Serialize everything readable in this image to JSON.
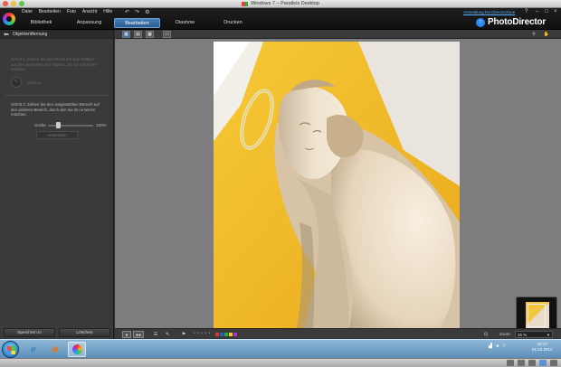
{
  "window": {
    "title": "Windows 7 – Parallels Desktop"
  },
  "menu": [
    "Datei",
    "Bearbeiten",
    "Foto",
    "Ansicht",
    "Hilfe"
  ],
  "header": {
    "register_link": "Anmeldung bei DirectorZone",
    "help": "?",
    "brand": "PhotoDirector"
  },
  "tabs": [
    {
      "label": "Bibliothek"
    },
    {
      "label": "Anpassung"
    },
    {
      "label": "Bearbeiten",
      "active": true
    },
    {
      "label": "Diashow"
    },
    {
      "label": "Drucken"
    }
  ],
  "panel": {
    "title": "Objektentfernung",
    "step1": "Schritt 1: Ziehen Sie den Pinsel mit dem Stiftbus aus den Bereichen des Objekts, die Sie entfernen möchten.",
    "brush_label": "Stiftbus",
    "step2": "Schritt 2: Ziehen Sie den ausgewählten Bereich auf den anderen Bereich, durch den Sie ihn ersetzen möchten.",
    "size_label": "Größe",
    "size_value": "100%",
    "apply": "Anwenden",
    "save_as": "Speichern in",
    "delete": "Löschen"
  },
  "bottombar": {
    "zoom_label": "Zoom:",
    "zoom_value": "25 %"
  },
  "taskbar": {
    "time": "19:17",
    "date": "01.03.2012"
  },
  "colors": {
    "accent": "#3b6aa0",
    "wall": "#f1c53a",
    "link": "#5ab0ff"
  }
}
